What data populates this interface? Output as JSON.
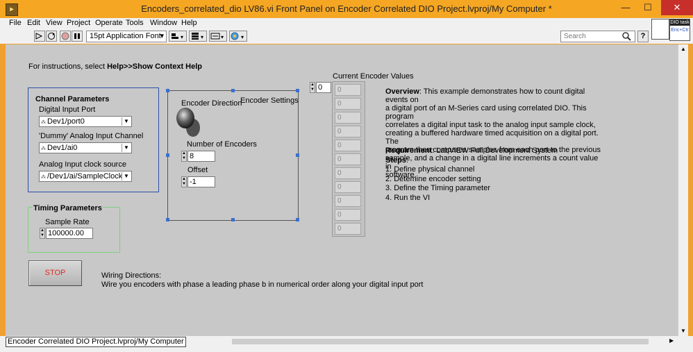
{
  "window": {
    "title": "Encoders_correlated_dio LV86.vi Front Panel on Encoder Correlated DIO Project.lvproj/My Computer *",
    "app_icon": "labview-icon",
    "controls": [
      "minimize",
      "maximize",
      "close"
    ]
  },
  "menu": [
    "File",
    "Edit",
    "View",
    "Project",
    "Operate",
    "Tools",
    "Window",
    "Help"
  ],
  "toolbar": {
    "font_select": "15pt Application Font",
    "search_placeholder": "Search",
    "help": "?"
  },
  "vi_icon": {
    "badge": "DIO task",
    "subtext": "Enc+Ctr"
  },
  "instructions": {
    "prefix": "For instructions, select ",
    "bold": "Help>>Show Context Help"
  },
  "channel": {
    "title": "Channel Parameters",
    "digital_label": "Digital Input Port",
    "digital_value": "Dev1/port0",
    "dummy_label": "'Dummy' Analog Input Channel",
    "dummy_value": "Dev1/ai0",
    "clock_label": "Analog Input clock source",
    "clock_value": "/Dev1/ai/SampleClock"
  },
  "timing": {
    "title": "Timing Parameters",
    "rate_label": "Sample Rate",
    "rate_value": "100000.00"
  },
  "encoder": {
    "settings_label": "Encoder Settings",
    "direction_label": "Encoder Direction",
    "count_label": "Number of Encoders",
    "count_value": "8",
    "offset_label": "Offset",
    "offset_value": "-1"
  },
  "current": {
    "label": "Current Encoder Values",
    "index": "0",
    "values": [
      "0",
      "0",
      "0",
      "0",
      "0",
      "0",
      "0",
      "0",
      "0",
      "0",
      "0"
    ]
  },
  "overview": {
    "overview_title": "Overview",
    "overview_lines": [
      ": This example demonstrates how to count digital events on",
      "a digital port of an M-Series card using correlated DIO.  This program",
      "correlates a digital input task to the analog input sample clock,",
      "creating a buffered hardware timed acquisition on a digital port.  The",
      "program then compares samples from each port to the previous",
      "sample, and a change in a digital line increments a count value in",
      "software."
    ],
    "req_title": "Requirement",
    "req_text": ": LabVIEW Full Development System",
    "steps_title": "Steps",
    "steps_colon": ":",
    "steps": [
      "1. Define physical channel",
      "2. Detemine encoder setting",
      "3. Define the Timing parameter",
      "4. Run the VI"
    ]
  },
  "stop_label": "STOP",
  "wiring": {
    "title": "Wiring Directions:",
    "text": "Wire you encoders with phase a leading phase b in numerical order along your digital input port"
  },
  "status": "Encoder Correlated DIO Project.lvproj/My Computer"
}
